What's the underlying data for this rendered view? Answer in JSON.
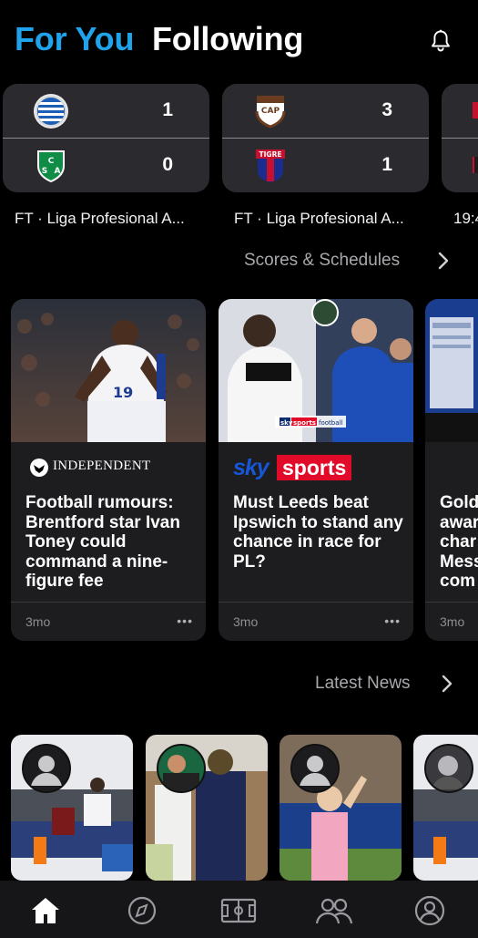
{
  "header": {
    "tabs": [
      {
        "label": "For You",
        "active": true
      },
      {
        "label": "Following",
        "active": false
      }
    ],
    "notifications_icon": "bell-icon"
  },
  "scores": {
    "matches": [
      {
        "home": {
          "crest": "godoy-cruz-crest",
          "score": "1"
        },
        "away": {
          "crest": "sarmiento-crest",
          "crest_text": "CSA",
          "score": "0"
        },
        "status": "FT · Liga Profesional A..."
      },
      {
        "home": {
          "crest": "platense-crest",
          "crest_text": "CAP",
          "score": "3"
        },
        "away": {
          "crest": "tigre-crest",
          "crest_text": "TIGRE",
          "score": "1"
        },
        "status": "FT · Liga Profesional A..."
      },
      {
        "status": "19:4"
      }
    ],
    "link_label": "Scores & Schedules"
  },
  "news": {
    "articles": [
      {
        "source": "INDEPENDENT",
        "headline": "Football rumours: Brentford star Ivan Toney could command a nine-figure fee",
        "age": "3mo",
        "more": "•••"
      },
      {
        "source_part1": "sky",
        "source_part2": "sports",
        "image_caption_part1": "sky",
        "image_caption_part2": "sports",
        "image_caption_part3": "football",
        "headline": "Must Leeds beat Ipswich to stand any chance in race for PL?",
        "age": "3mo",
        "more": "•••"
      },
      {
        "headline": "Gold awar char Mess com",
        "age": "3mo"
      }
    ],
    "link_label": "Latest News"
  },
  "colors": {
    "accent": "#1fa3ea",
    "background": "#000000",
    "card": "#2b2b2f",
    "news_card": "#1d1d20",
    "sky_red": "#e10a28"
  },
  "bottom_nav": {
    "items": [
      {
        "icon": "home-icon",
        "active": true
      },
      {
        "icon": "compass-icon",
        "active": false
      },
      {
        "icon": "pitch-icon",
        "active": false
      },
      {
        "icon": "people-icon",
        "active": false
      },
      {
        "icon": "profile-icon",
        "active": false
      }
    ]
  }
}
